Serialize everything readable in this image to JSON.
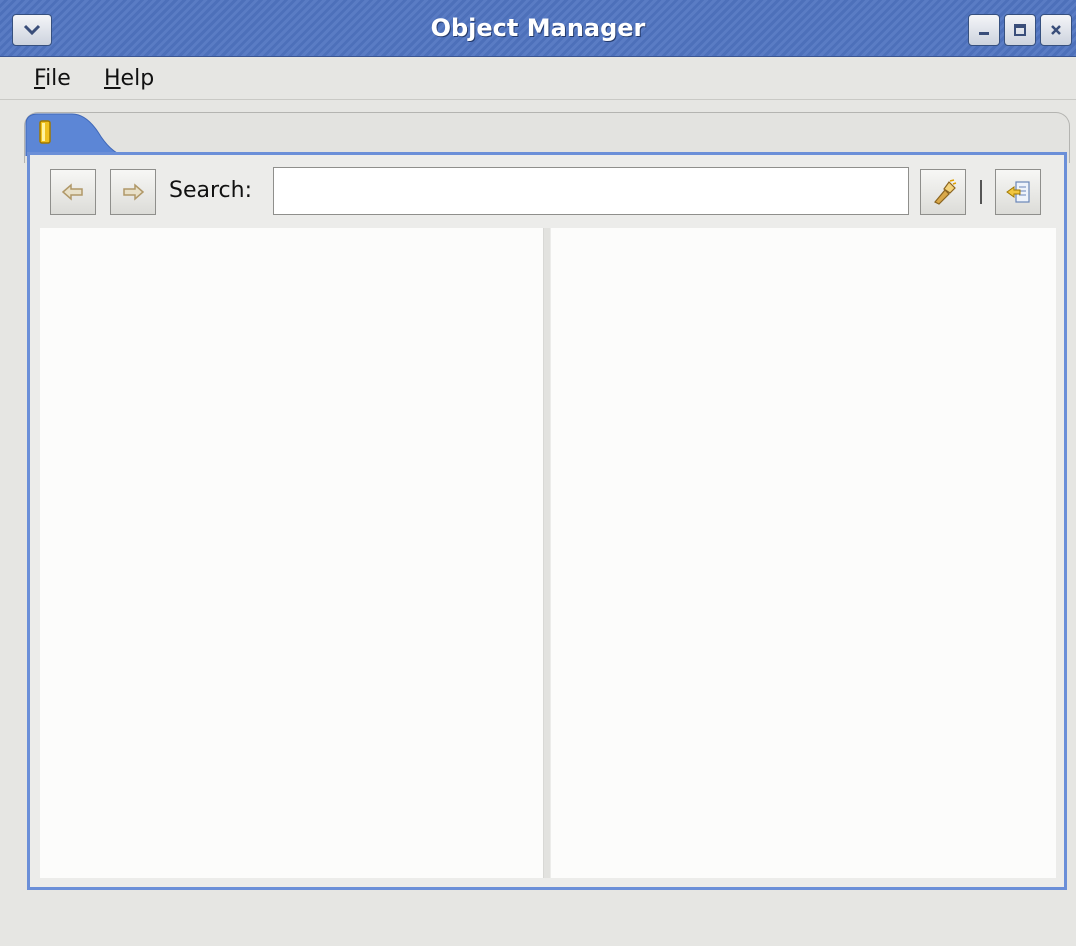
{
  "window": {
    "title": "Object Manager",
    "menu_icon": "chevron-down-icon",
    "controls": [
      "minimize-icon",
      "maximize-icon",
      "close-icon"
    ]
  },
  "menubar": {
    "items": [
      {
        "mnemonic": "F",
        "rest": "ile"
      },
      {
        "mnemonic": "H",
        "rest": "elp"
      }
    ]
  },
  "tab": {
    "icon": "object-icon",
    "accent": "#e8b400"
  },
  "toolbar": {
    "back_icon": "arrow-left-icon",
    "forward_icon": "arrow-right-icon",
    "search_label": "Search:",
    "search_value": "",
    "search_placeholder": "",
    "flashlight_icon": "flashlight-icon",
    "separator": "|",
    "export_icon": "export-icon"
  },
  "colors": {
    "titlebar": "#5a7cc4",
    "panel_border": "#6b8fd8",
    "pane_bg": "#fcfcfb"
  }
}
